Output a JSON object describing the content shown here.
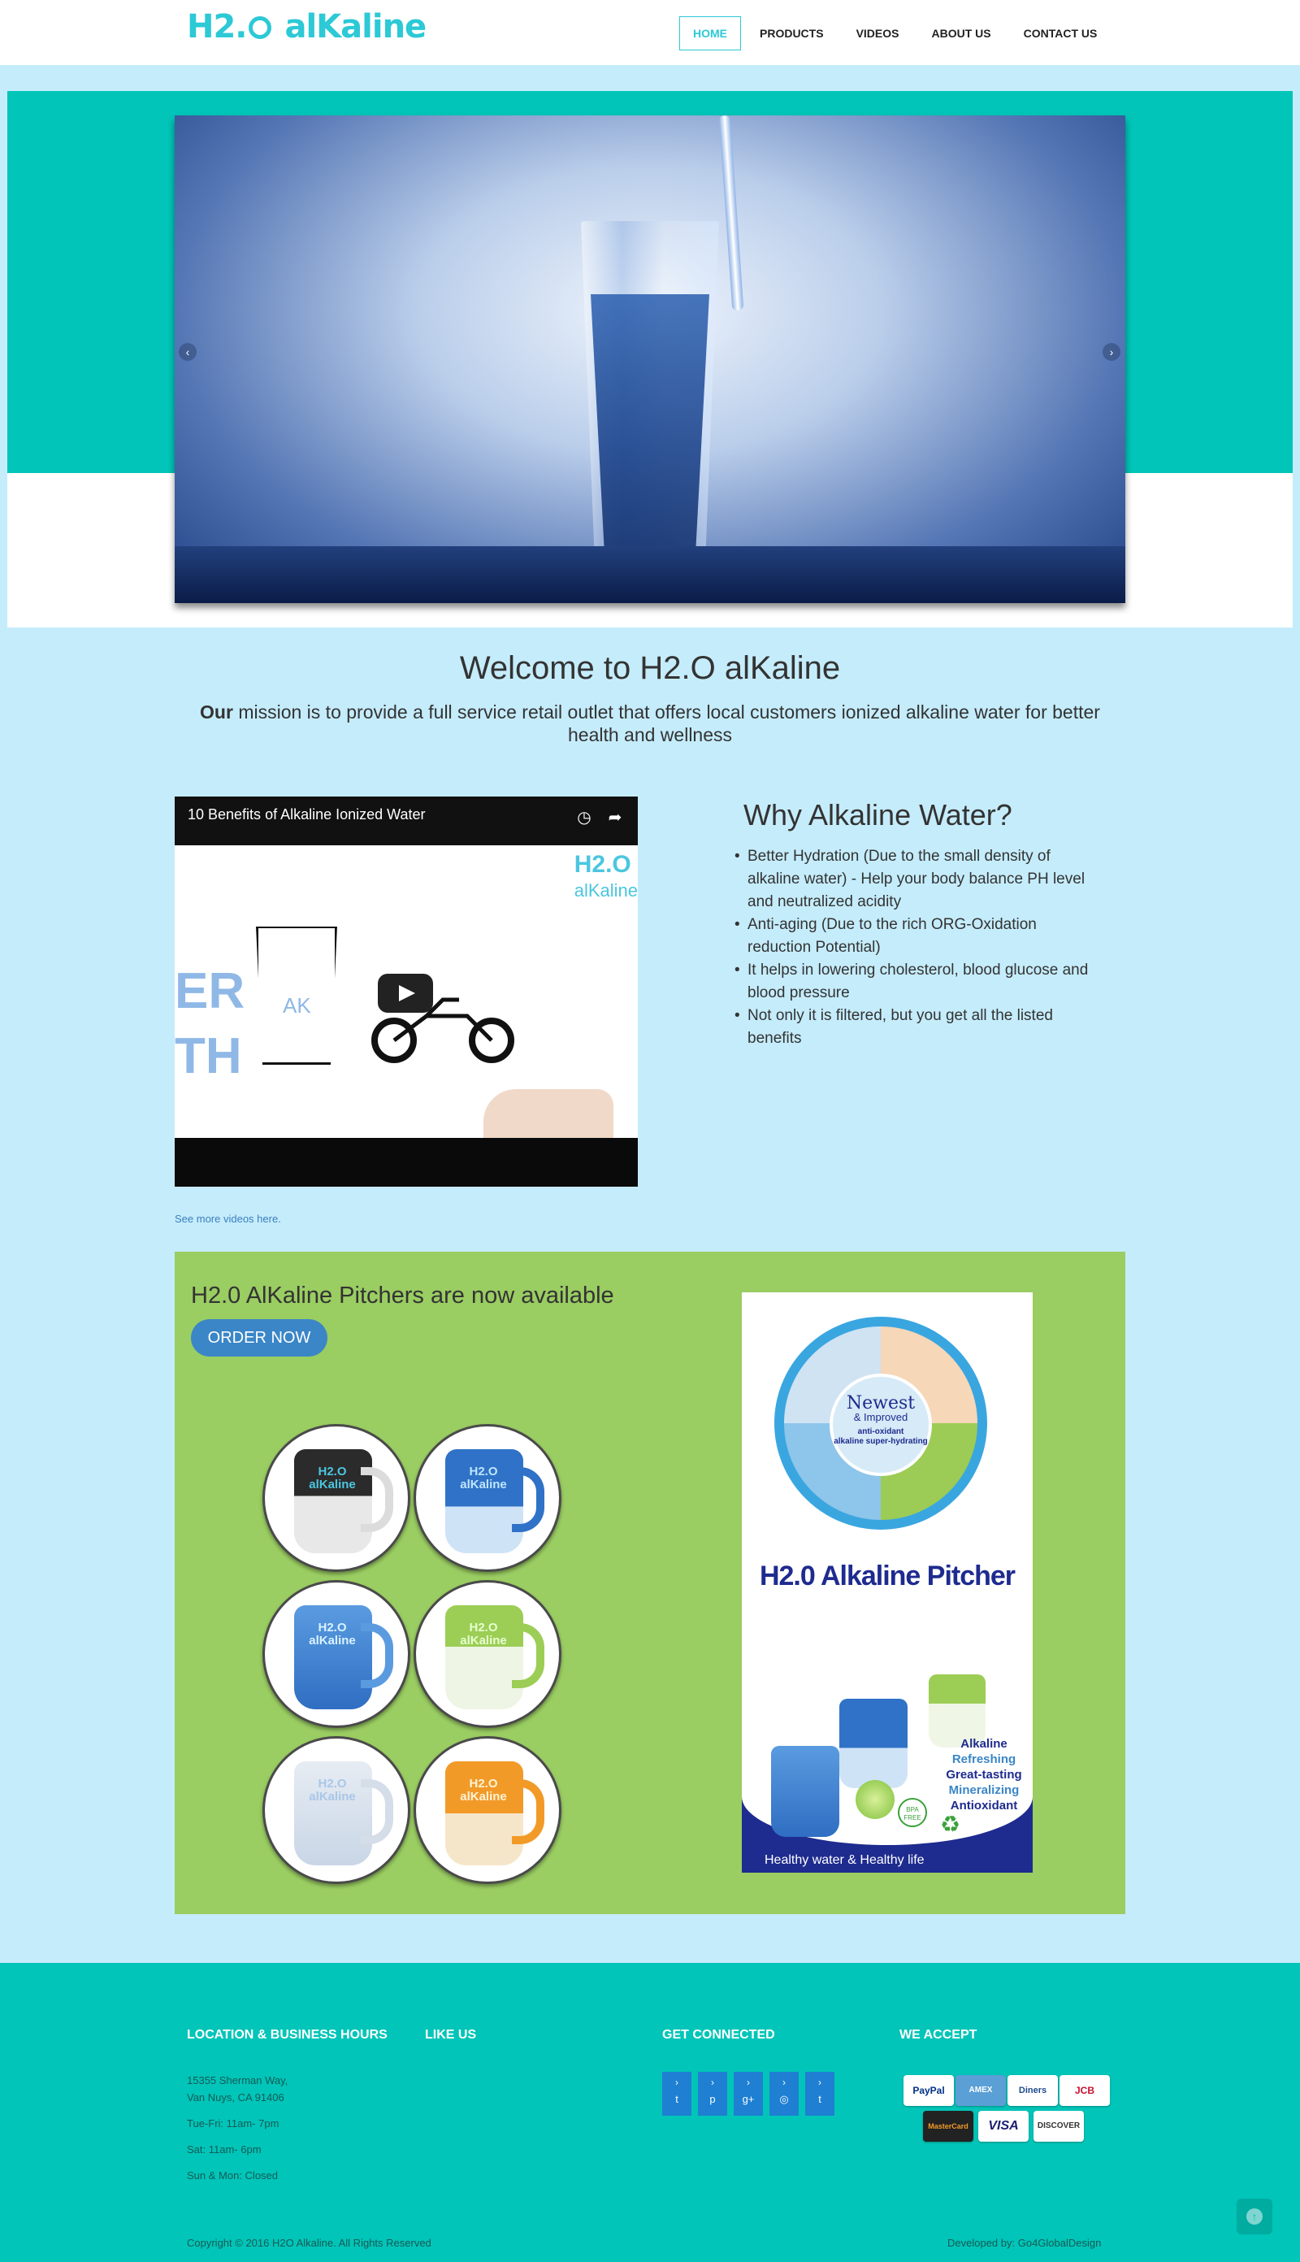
{
  "header": {
    "logo_h2": "H2.",
    "logo_rest": "alKaline",
    "nav": [
      "HOME",
      "PRODUCTS",
      "VIDEOS",
      "ABOUT US",
      "CONTACT US"
    ]
  },
  "slider": {
    "prev_arrow": "‹",
    "next_arrow": "›"
  },
  "welcome": {
    "title": "Welcome to H2.O alKaline",
    "mission_bold": "Our",
    "mission_text": " mission is to provide a full service retail outlet that offers local customers ionized alkaline water for better health and wellness"
  },
  "video": {
    "title": "10 Benefits of Alkaline Ionized Water",
    "brand_top": "H2.O",
    "brand_bottom": "alKaline",
    "side_text": "ER\nTH",
    "glass_label": "AK"
  },
  "why": {
    "title": "Why Alkaline Water?",
    "items": [
      "Better Hydration (Due to the small density of alkaline water) - Help your body balance PH level and neutralized acidity",
      "Anti-aging (Due to the rich ORG-Oxidation reduction Potential)",
      "It helps in lowering cholesterol, blood glucose and blood pressure",
      "Not only it is filtered, but you get all the listed benefits"
    ]
  },
  "see_more": "See more videos here.",
  "pitchers": {
    "title": "H2.0 AlKaline Pitchers are now available",
    "order_button": "ORDER NOW",
    "pitcher_logo": "H2.O alKaline",
    "poster": {
      "newest": "Newest",
      "improved": "& Improved",
      "tagline1": "anti-oxidant",
      "tagline2": "alkaline super-hydrating",
      "title": "H2.0 Alkaline Pitcher",
      "features": [
        "Alkaline",
        "Refreshing",
        "Great-tasting",
        "Mineralizing",
        "Antioxidant"
      ],
      "bpa": "BPA FREE",
      "footer": "Healthy water & Healthy life"
    }
  },
  "footer": {
    "location_heading": "LOCATION & BUSINESS HOURS",
    "like_heading": "LIKE US",
    "connected_heading": "GET CONNECTED",
    "accept_heading": "WE ACCEPT",
    "address1": "15355 Sherman Way,",
    "address2": "Van Nuys, CA 91406",
    "hours1": "Tue-Fri: 11am- 7pm",
    "hours2": "Sat: 11am- 6pm",
    "hours3": "Sun & Mon: Closed",
    "social_icons": [
      "twitter-icon",
      "pinterest-icon",
      "google-plus-icon",
      "instagram-icon",
      "tumblr-icon"
    ],
    "social_glyphs": [
      "t",
      "p",
      "g+",
      "◎",
      "t"
    ],
    "payments": [
      "PayPal",
      "AMEX",
      "Diners",
      "JCB",
      "MasterCard",
      "VISA",
      "DISCOVER"
    ],
    "copyright": "Copyright © 2016 H2O Alkaline. All Rights Reserved",
    "developer": "Developed by: Go4GlobalDesign"
  },
  "colors": {
    "brand": "#2cc9d6",
    "teal": "#00c5b8",
    "page_bg": "#c5ecfb",
    "green_panel": "#9acd62",
    "button_blue": "#3a86c7"
  }
}
